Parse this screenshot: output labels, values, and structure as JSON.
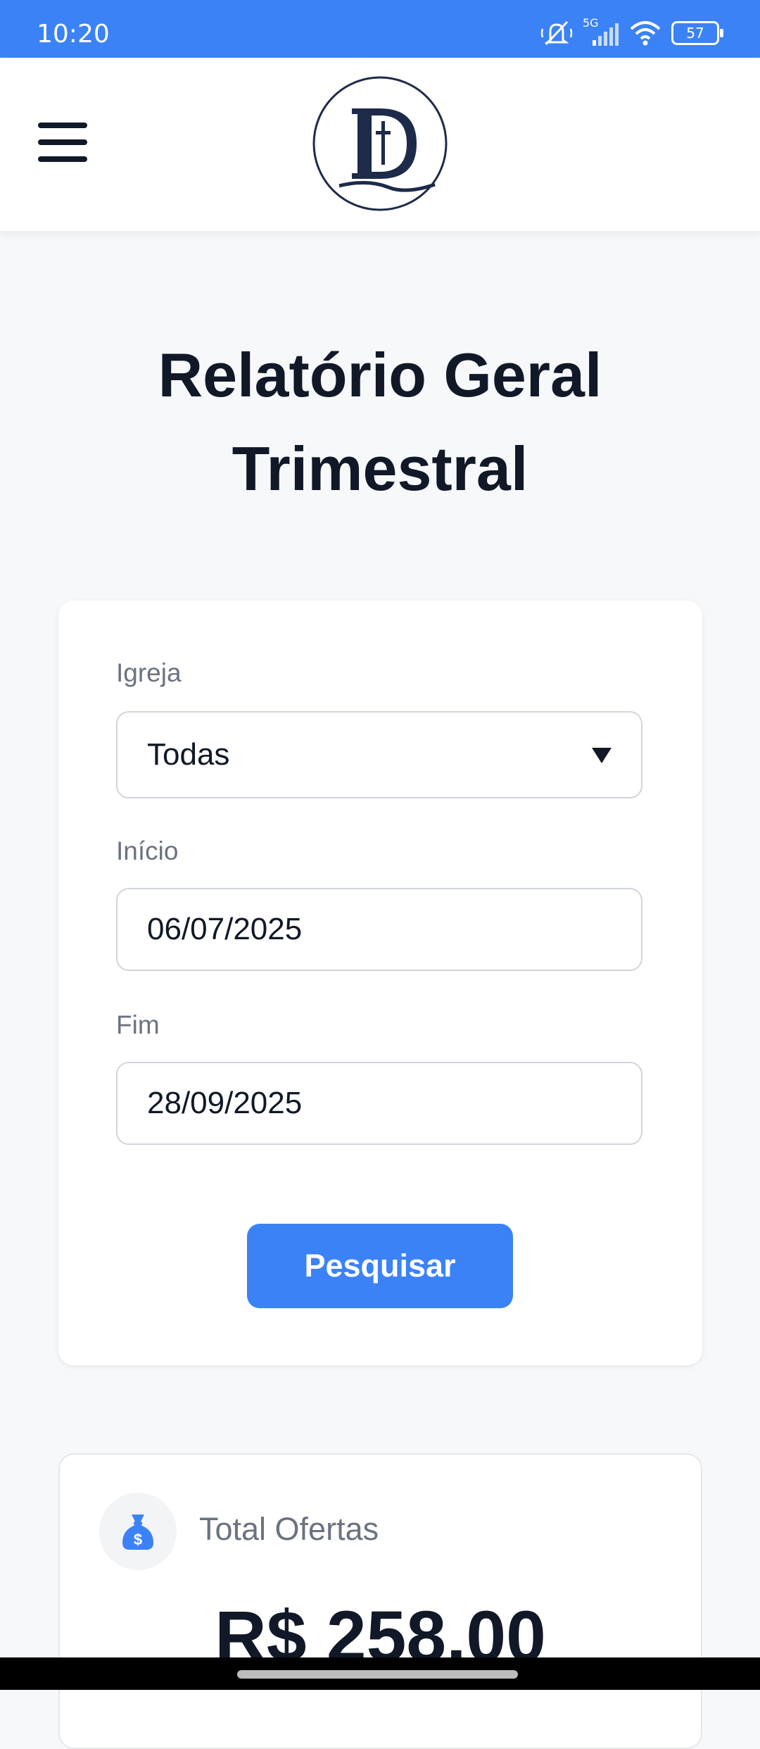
{
  "status_bar": {
    "time": "10:20",
    "network": "5G",
    "battery": "57",
    "icons": [
      "mute-icon",
      "signal-icon",
      "wifi-icon",
      "battery-icon"
    ]
  },
  "header": {
    "menu_icon": "hamburger-menu-icon",
    "logo_icon": "church-logo-icon"
  },
  "page": {
    "title_line1": "Relatório Geral",
    "title_line2": "Trimestral"
  },
  "filters": {
    "church_label": "Igreja",
    "church_value": "Todas",
    "start_label": "Início",
    "start_value": "06/07/2025",
    "end_label": "Fim",
    "end_value": "28/09/2025",
    "search_label": "Pesquisar"
  },
  "summary": {
    "icon": "money-bag-icon",
    "label": "Total Ofertas",
    "value": "R$ 258,00"
  },
  "colors": {
    "accent": "#3b82f6",
    "text_dark": "#111827",
    "text_muted": "#6b7280",
    "background": "#f7f8fa",
    "logo_navy": "#1e2a4a"
  }
}
